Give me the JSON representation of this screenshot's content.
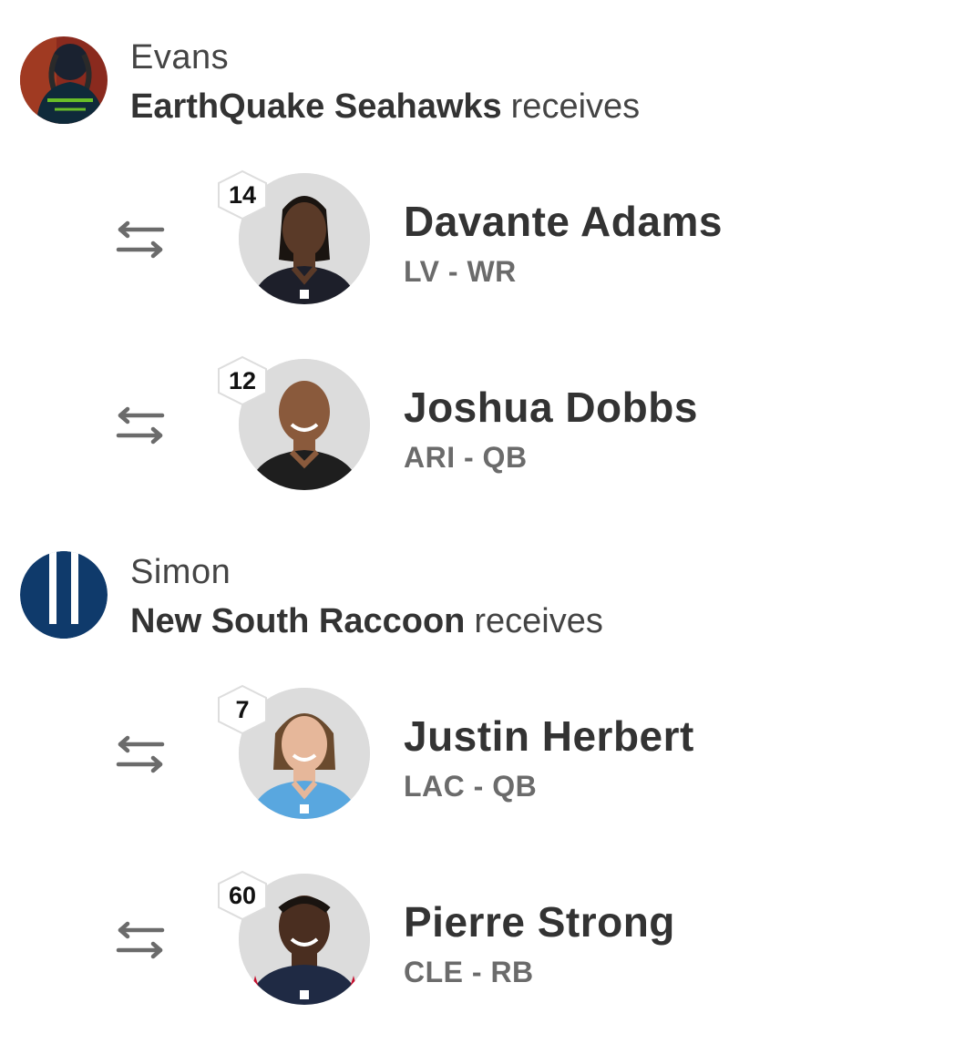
{
  "trades": [
    {
      "owner": "Evans",
      "team_name": "EarthQuake Seahawks",
      "receives_label": "receives",
      "avatar_icon": "seahawks-player-avatar",
      "players": [
        {
          "rank": "14",
          "name": "Davante Adams",
          "meta": "LV - WR",
          "jersey_color": "#1d1f2a",
          "skin_color": "#5a3a28"
        },
        {
          "rank": "12",
          "name": "Joshua Dobbs",
          "meta": "ARI - QB",
          "jersey_color": "#1e1e1e",
          "skin_color": "#8a5a3c"
        }
      ]
    },
    {
      "owner": "Simon",
      "team_name": "New South Raccoon",
      "receives_label": "receives",
      "avatar_icon": "three-bars-logo",
      "players": [
        {
          "rank": "7",
          "name": "Justin Herbert",
          "meta": "LAC - QB",
          "jersey_color": "#59a7df",
          "skin_color": "#e6b79a"
        },
        {
          "rank": "60",
          "name": "Pierre Strong",
          "meta": "CLE - RB",
          "jersey_color": "#1f2a44",
          "skin_color": "#4a2e20"
        }
      ]
    }
  ],
  "colors": {
    "raccoon_logo_bg": "#0f3a6b",
    "seahawks_green": "#69be28",
    "trade_icon": "#6b6b6b"
  }
}
